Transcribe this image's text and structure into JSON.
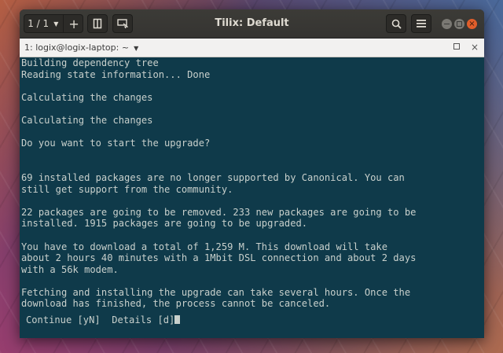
{
  "window": {
    "title": "Tilix: Default",
    "session_label": "1 / 1",
    "add_label": "+"
  },
  "tab": {
    "title": "1: logix@logix-laptop: ~",
    "close_label": "×"
  },
  "terminal": {
    "lines": [
      "Building dependency tree",
      "Reading state information... Done",
      "",
      "Calculating the changes",
      "",
      "Calculating the changes",
      "",
      "Do you want to start the upgrade?",
      "",
      "",
      "69 installed packages are no longer supported by Canonical. You can",
      "still get support from the community.",
      "",
      "22 packages are going to be removed. 233 new packages are going to be",
      "installed. 1915 packages are going to be upgraded.",
      "",
      "You have to download a total of 1,259 M. This download will take",
      "about 2 hours 40 minutes with a 1Mbit DSL connection and about 2 days",
      "with a 56k modem.",
      "",
      "Fetching and installing the upgrade can take several hours. Once the",
      "download has finished, the process cannot be canceled."
    ],
    "prompt": "Continue [yN]  Details [d]"
  },
  "icons": {
    "split": "split-terminal-icon",
    "sync": "sync-input-icon",
    "search": "search-icon",
    "menu": "hamburger-menu-icon"
  },
  "colors": {
    "terminal_bg": "#0f3a4a",
    "terminal_fg": "#c8d0cc",
    "close_button": "#e05e2b"
  }
}
